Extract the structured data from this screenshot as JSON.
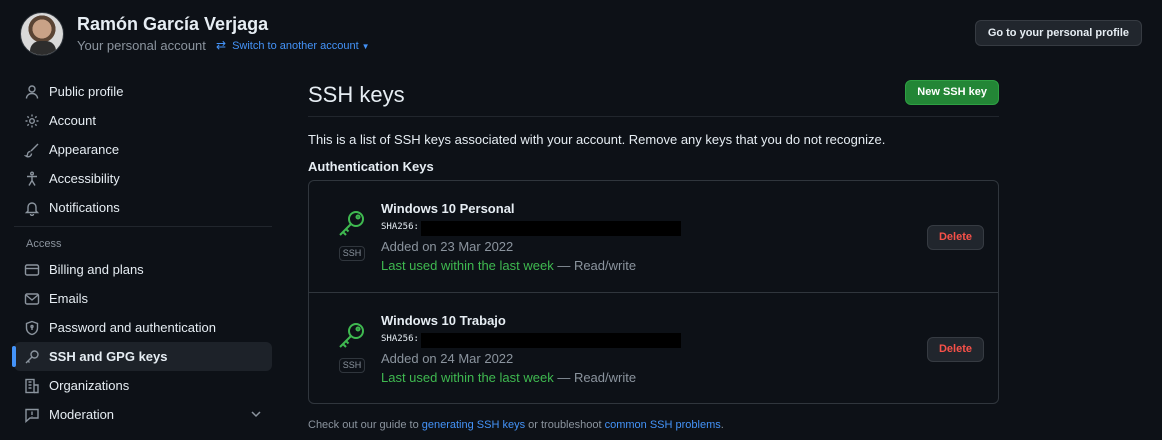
{
  "header": {
    "user_name": "Ramón García Verjaga",
    "account_type": "Your personal account",
    "switch_label": "Switch to another account",
    "profile_button": "Go to your personal profile"
  },
  "sidebar": {
    "items_top": [
      {
        "label": "Public profile",
        "icon": "person-icon"
      },
      {
        "label": "Account",
        "icon": "gear-icon"
      },
      {
        "label": "Appearance",
        "icon": "paintbrush-icon"
      },
      {
        "label": "Accessibility",
        "icon": "accessibility-icon"
      },
      {
        "label": "Notifications",
        "icon": "bell-icon"
      }
    ],
    "section_label": "Access",
    "items_access": [
      {
        "label": "Billing and plans",
        "icon": "credit-card-icon"
      },
      {
        "label": "Emails",
        "icon": "mail-icon"
      },
      {
        "label": "Password and authentication",
        "icon": "shield-lock-icon"
      },
      {
        "label": "SSH and GPG keys",
        "icon": "key-icon",
        "active": true
      },
      {
        "label": "Organizations",
        "icon": "organization-icon"
      },
      {
        "label": "Moderation",
        "icon": "report-icon"
      }
    ]
  },
  "main": {
    "title": "SSH keys",
    "new_button": "New SSH key",
    "description": "This is a list of SSH keys associated with your account. Remove any keys that you do not recognize.",
    "auth_heading": "Authentication Keys",
    "keys": [
      {
        "name": "Windows 10 Personal",
        "fingerprint_label": "SHA256:",
        "added": "Added on 23 Mar 2022",
        "last_used": "Last used within the last week",
        "access": " — Read/write",
        "badge": "SSH",
        "delete_label": "Delete"
      },
      {
        "name": "Windows 10 Trabajo",
        "fingerprint_label": "SHA256:",
        "added": "Added on 24 Mar 2022",
        "last_used": "Last used within the last week",
        "access": " — Read/write",
        "badge": "SSH",
        "delete_label": "Delete"
      }
    ],
    "footer": {
      "text1": "Check out our guide to ",
      "link1": "generating SSH keys",
      "text2": " or troubleshoot ",
      "link2": "common SSH problems",
      "text3": "."
    }
  },
  "colors": {
    "background": "#0d1117",
    "accent_blue": "#4493f8",
    "primary_green": "#238636",
    "danger_red": "#f85149",
    "used_green": "#3fb950"
  }
}
